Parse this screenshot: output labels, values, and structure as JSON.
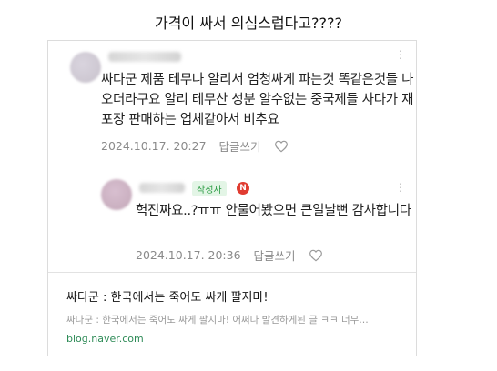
{
  "headline": "가격이 싸서 의심스럽다고????",
  "comments": [
    {
      "text": "싸다군 제품 테무나 알리서 엄청싸게 파는것 똑같은것들 나오더라구요 알리 테무산 성분 알수없는 중국제들 사다가 재포장 판매하는 업체같아서 비추요",
      "date": "2024.10.17. 20:27",
      "reply_label": "답글쓰기",
      "more_icon": "more-vertical-icon",
      "like_icon": "heart-outline-icon"
    },
    {
      "author_badge": "작성자",
      "n_badge": "N",
      "text": "헉진짜요..?ㅠㅠ 안물어봤으면 큰일날뻔 감사합니다",
      "date": "2024.10.17. 20:36",
      "reply_label": "답글쓰기",
      "more_icon": "more-vertical-icon",
      "like_icon": "heart-outline-icon"
    }
  ],
  "link_preview": {
    "title": "싸다군 : 한국에서는 죽어도 싸게 팔지마!",
    "description": "싸다군 : 한국에서는 죽어도 싸게 팔지마! 어쩌다 발견하게된 글 ㅋㅋ 너무…",
    "domain": "blog.naver.com"
  },
  "colors": {
    "author_badge_bg": "#e3f5e6",
    "author_badge_text": "#2d9c45",
    "n_badge": "#e03c31",
    "domain": "#2e8b57"
  }
}
